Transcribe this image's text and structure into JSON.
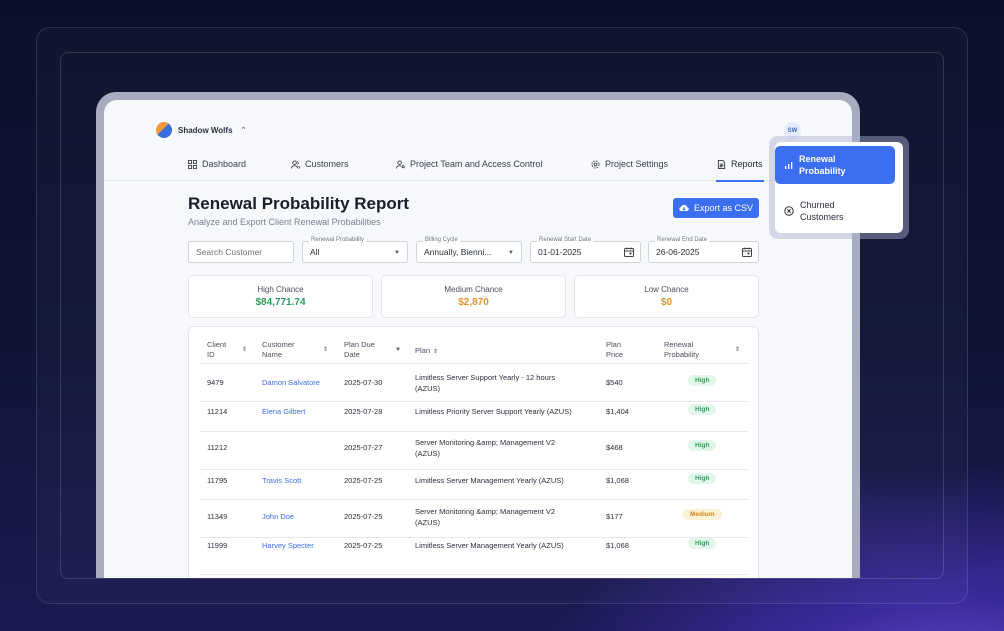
{
  "org": {
    "name": "Shadow Wolfs",
    "chevron": "⌃"
  },
  "user": {
    "initials": "SW"
  },
  "nav": [
    {
      "label": "Dashboard",
      "icon": "grid-icon"
    },
    {
      "label": "Customers",
      "icon": "users-icon"
    },
    {
      "label": "Project Team and Access Control",
      "icon": "user-key-icon"
    },
    {
      "label": "Project Settings",
      "icon": "gear-icon"
    },
    {
      "label": "Reports",
      "icon": "document-icon"
    }
  ],
  "page": {
    "title": "Renewal Probability Report",
    "subtitle": "Analyze and Export Client Renewal Probabilities",
    "export_label": "Export as CSV"
  },
  "filters": {
    "search_placeholder": "Search Customer",
    "probability": {
      "label": "Renewal Probability",
      "value": "All"
    },
    "billing": {
      "label": "Billing Cycle",
      "value": "Annually, Bienni..."
    },
    "start": {
      "label": "Renewal Start Date",
      "value": "01-01-2025"
    },
    "end": {
      "label": "Renewal End Date",
      "value": "26-06-2025"
    }
  },
  "summary": [
    {
      "label": "High Chance",
      "value": "$84,771.74",
      "color": "#2e9c5b"
    },
    {
      "label": "Medium Chance",
      "value": "$2,870",
      "color": "#e0932a"
    },
    {
      "label": "Low Chance",
      "value": "$0",
      "color": "#e0932a"
    }
  ],
  "table": {
    "headers": [
      [
        "Client",
        "ID"
      ],
      [
        "Customer",
        "Name"
      ],
      [
        "Plan Due",
        "Date"
      ],
      [
        "Plan",
        ""
      ],
      [
        "Plan",
        "Price"
      ],
      [
        "Renewal",
        "Probability"
      ]
    ],
    "rows": [
      {
        "id": "9479",
        "name": "Damon Salvatore",
        "date": "2025-07-30",
        "plan": [
          "Limitless Server Support Yearly - 12 hours",
          "(AZUS)"
        ],
        "price": "$540",
        "prob": "High"
      },
      {
        "id": "11214",
        "name": "Elena Gilbert",
        "date": "2025-07-28",
        "plan": [
          "Limitless Priority Server Support Yearly (AZUS)",
          ""
        ],
        "price": "$1,404",
        "prob": "High"
      },
      {
        "id": "11212",
        "name": "",
        "date": "2025-07-27",
        "plan": [
          "Server Monitoring &amp; Management V2",
          "(AZUS)"
        ],
        "price": "$468",
        "prob": "High"
      },
      {
        "id": "11795",
        "name": "Travis Scott",
        "date": "2025-07-25",
        "plan": [
          "Limitless Server Management Yearly (AZUS)",
          ""
        ],
        "price": "$1,068",
        "prob": "High"
      },
      {
        "id": "11349",
        "name": "John Doe",
        "date": "2025-07-25",
        "plan": [
          "Server Monitoring &amp; Management V2",
          "(AZUS)"
        ],
        "price": "$177",
        "prob": "Medium"
      },
      {
        "id": "11999",
        "name": "Harvey Specter",
        "date": "2025-07-25",
        "plan": [
          "Limitless Server Management Yearly (AZUS)",
          ""
        ],
        "price": "$1,068",
        "prob": "High"
      }
    ]
  },
  "reports_menu": [
    {
      "label": [
        "Renewal",
        "Probability"
      ],
      "icon": "bar-chart-icon",
      "active": true
    },
    {
      "label": [
        "Churned",
        "Customers"
      ],
      "icon": "x-circle-icon",
      "active": false
    }
  ],
  "colors": {
    "accent": "#3b6ef0",
    "high": "#2e9c5b",
    "medium": "#c98a16"
  }
}
